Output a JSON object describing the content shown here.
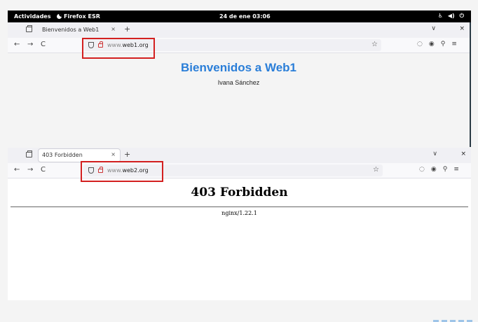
{
  "topbar": {
    "activities": "Actividades",
    "app_name": "Firefox ESR",
    "clock": "24 de ene  03:06",
    "tray_icons": [
      "accessibility-icon",
      "volume-icon",
      "power-icon"
    ]
  },
  "window1": {
    "tab_title": "Bienvenidos a Web1",
    "url_prefix": "www.",
    "url_domain": "web1.org",
    "heading": "Bienvenidos a Web1",
    "author": "Ivana Sánchez"
  },
  "window2": {
    "tab_title": "403 Forbidden",
    "url_prefix": "www.",
    "url_domain": "web2.org",
    "heading": "403 Forbidden",
    "server": "nginx/1.22.1"
  },
  "glyphs": {
    "close": "×",
    "plus": "+",
    "back": "←",
    "forward": "→",
    "reload": "C",
    "chevron": "∨",
    "star": "☆",
    "pocket": "◌",
    "account": "◉",
    "extensions": "⚲",
    "menu": "≡"
  },
  "colors": {
    "highlight": "#d32020",
    "heading_web1": "#2a7ed8",
    "topbar": "#000000"
  }
}
